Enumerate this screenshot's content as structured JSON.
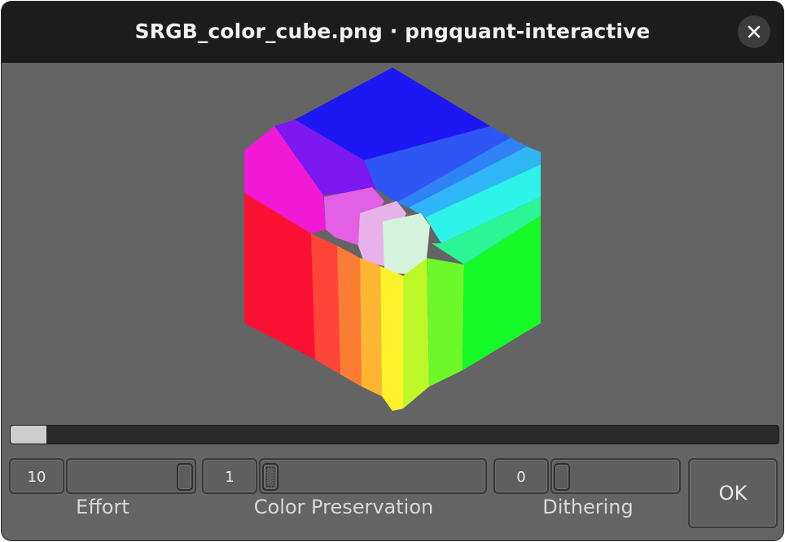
{
  "window": {
    "title": "SRGB_color_cube.png · pngquant-interactive"
  },
  "icons": {
    "close": "close-icon"
  },
  "preview": {
    "image": "quantized sRGB color cube",
    "colors": {
      "top_blue": "#1f17f2",
      "violet": "#7f16f2",
      "magenta": "#f719d8",
      "red": "#fc1133",
      "green": "#17fa26",
      "cyan": "#2ef5e8",
      "yellow": "#fdf62c",
      "white_center": "#d7f2dc"
    }
  },
  "progress": {
    "fraction": 0.047
  },
  "controls": {
    "effort": {
      "value": "10",
      "label": "Effort",
      "position": 1.0
    },
    "color_preservation": {
      "value": "1",
      "label": "Color Preservation",
      "position": 0.0
    },
    "dithering": {
      "value": "0",
      "label": "Dithering",
      "position": 0.0
    },
    "ok_label": "OK"
  }
}
